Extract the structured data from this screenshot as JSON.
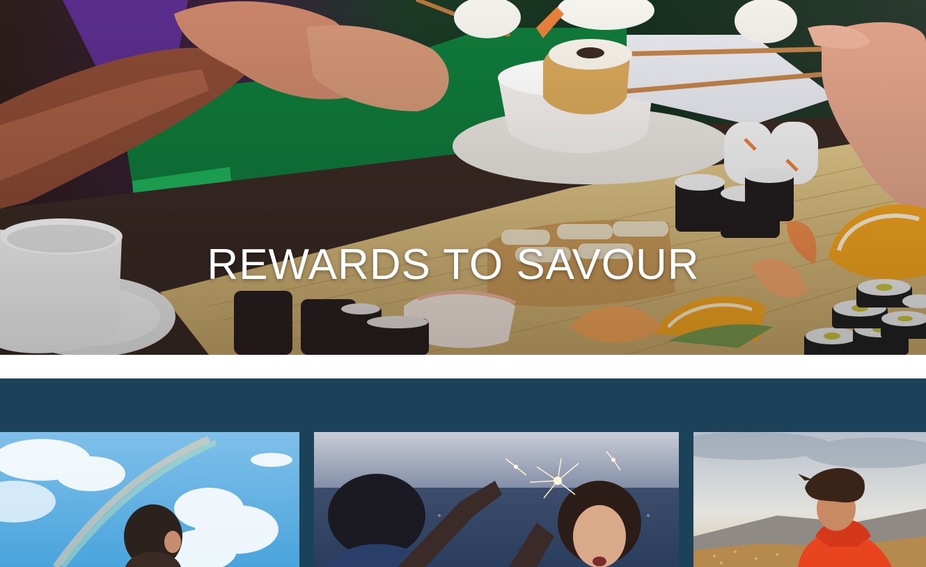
{
  "hero": {
    "title": "REWARDS TO SAVOUR",
    "image_subject": "people-eating-sushi-with-chopsticks"
  },
  "band": {
    "color": "#1c4259"
  },
  "cards": [
    {
      "image_subject": "woman-under-rainbow-sky"
    },
    {
      "image_subject": "friends-with-sparklers-at-dusk"
    },
    {
      "image_subject": "man-in-red-jacket-overlooking-city"
    }
  ]
}
